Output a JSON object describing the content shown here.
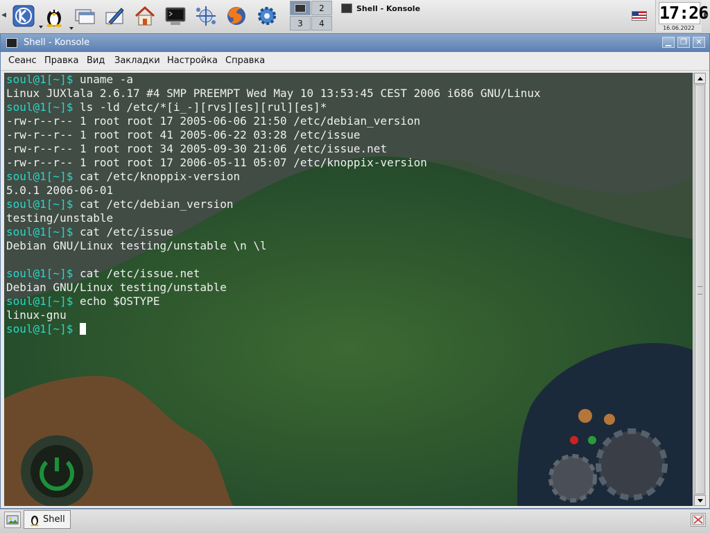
{
  "panel": {
    "launchers": [
      "kde-menu-icon",
      "tux-icon",
      "window-list-icon",
      "kate-editor-icon",
      "home-icon",
      "konsole-icon",
      "network-icon",
      "firefox-icon",
      "settings-gear-icon"
    ],
    "desktops": [
      "1",
      "2",
      "3",
      "4"
    ],
    "active_desktop": "1",
    "task_title": "Shell - Konsole",
    "keyboard_layout": "us-flag-icon",
    "clock_time": "17:26",
    "clock_date": "16.06.2022"
  },
  "window": {
    "title": "Shell - Konsole",
    "buttons": {
      "minimize": "minimize-icon",
      "maximize": "maximize-icon",
      "close": "close-icon"
    },
    "menu": [
      "Сеанс",
      "Правка",
      "Вид",
      "Закладки",
      "Настройка",
      "Справка"
    ]
  },
  "terminal": {
    "lines": [
      {
        "prompt": "soul@1[~]$ ",
        "text": "uname -a"
      },
      {
        "prompt": "",
        "text": "Linux JUXlala 2.6.17 #4 SMP PREEMPT Wed May 10 13:53:45 CEST 2006 i686 GNU/Linux"
      },
      {
        "prompt": "soul@1[~]$ ",
        "text": "ls -ld /etc/*[i_-][rvs][es][rul][es]*"
      },
      {
        "prompt": "",
        "text": "-rw-r--r-- 1 root root 17 2005-06-06 21:50 /etc/debian_version"
      },
      {
        "prompt": "",
        "text": "-rw-r--r-- 1 root root 41 2005-06-22 03:28 /etc/issue"
      },
      {
        "prompt": "",
        "text": "-rw-r--r-- 1 root root 34 2005-09-30 21:06 /etc/issue.net"
      },
      {
        "prompt": "",
        "text": "-rw-r--r-- 1 root root 17 2006-05-11 05:07 /etc/knoppix-version"
      },
      {
        "prompt": "soul@1[~]$ ",
        "text": "cat /etc/knoppix-version"
      },
      {
        "prompt": "",
        "text": "5.0.1 2006-06-01"
      },
      {
        "prompt": "soul@1[~]$ ",
        "text": "cat /etc/debian_version"
      },
      {
        "prompt": "",
        "text": "testing/unstable"
      },
      {
        "prompt": "soul@1[~]$ ",
        "text": "cat /etc/issue"
      },
      {
        "prompt": "",
        "text": "Debian GNU/Linux testing/unstable \\n \\l"
      },
      {
        "prompt": "",
        "text": ""
      },
      {
        "prompt": "soul@1[~]$ ",
        "text": "cat /etc/issue.net"
      },
      {
        "prompt": "",
        "text": "Debian GNU/Linux testing/unstable"
      },
      {
        "prompt": "soul@1[~]$ ",
        "text": "echo $OSTYPE"
      },
      {
        "prompt": "",
        "text": "linux-gnu"
      },
      {
        "prompt": "soul@1[~]$ ",
        "text": "",
        "cursor": true
      }
    ],
    "colors": {
      "prompt": "#2ad6c8",
      "text": "#f0f0f0"
    }
  },
  "taskbar": {
    "show_desktop_icon": "show-desktop-icon",
    "tasks": [
      {
        "label": "Shell",
        "icon": "tux-icon"
      }
    ],
    "tray_icon": "tray-close-icon"
  }
}
